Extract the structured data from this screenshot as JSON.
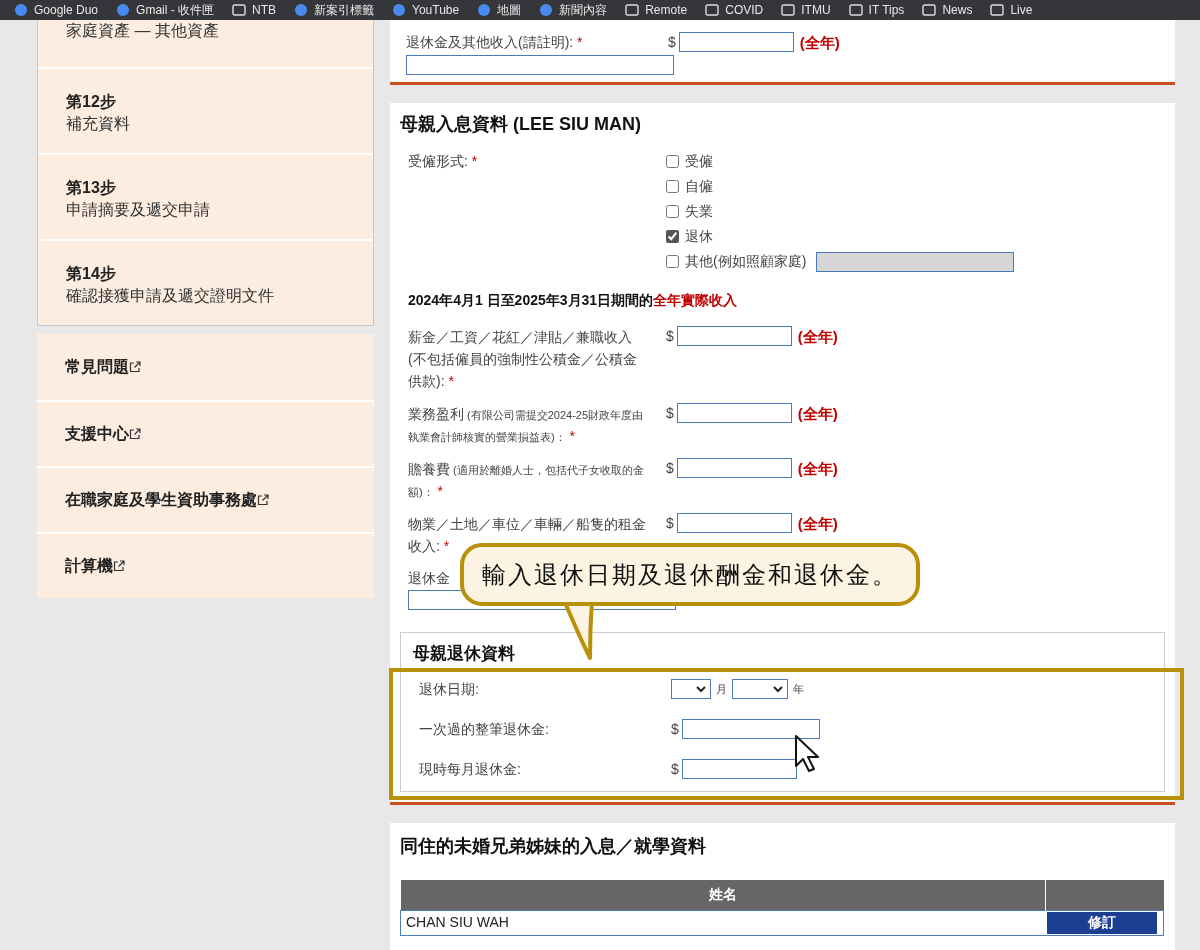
{
  "bookmarks": [
    {
      "label": "Google Duo",
      "kind": "site"
    },
    {
      "label": "Gmail - 收件匣",
      "kind": "site"
    },
    {
      "label": "NTB",
      "kind": "folder"
    },
    {
      "label": "新案引標籤",
      "kind": "site"
    },
    {
      "label": "YouTube",
      "kind": "site"
    },
    {
      "label": "地圖",
      "kind": "site"
    },
    {
      "label": "新聞內容",
      "kind": "site"
    },
    {
      "label": "Remote",
      "kind": "folder"
    },
    {
      "label": "COVID",
      "kind": "folder"
    },
    {
      "label": "ITMU",
      "kind": "folder"
    },
    {
      "label": "IT Tips",
      "kind": "folder"
    },
    {
      "label": "News",
      "kind": "folder"
    },
    {
      "label": "Live",
      "kind": "folder"
    }
  ],
  "sidebar": {
    "steps": [
      {
        "title": "家庭資產 — 其他資產"
      },
      {
        "step": "第12步",
        "title": "補充資料"
      },
      {
        "step": "第13步",
        "title": "申請摘要及遞交申請"
      },
      {
        "step": "第14步",
        "title": "確認接獲申請及遞交證明文件"
      }
    ],
    "links": [
      "常見問題",
      "支援中心",
      "在職家庭及學生資助事務處",
      "計算機"
    ]
  },
  "top_field": {
    "label": "退休金及其他收入(請註明):",
    "mark": "*",
    "currency": "$",
    "suffix": "(全年)"
  },
  "mother": {
    "title": "母親入息資料 (LEE SIU MAN)",
    "employment": {
      "label": "受僱形式:",
      "mark": "*",
      "options": [
        {
          "label": "受僱",
          "checked": false
        },
        {
          "label": "自僱",
          "checked": false
        },
        {
          "label": "失業",
          "checked": false
        },
        {
          "label": "退休",
          "checked": true
        },
        {
          "label": "其他(例如照顧家庭)",
          "checked": false,
          "other_field": true
        }
      ]
    },
    "income_heading": "2024年4月1 日至2025年3月31日期間的",
    "income_heading_red": "全年實際收入",
    "incomes": [
      {
        "label": "薪金／工資／花紅／津貼／兼職收入 (不包括僱員的強制性公積金／公積金供款):",
        "mark": "*",
        "currency": "$",
        "suffix": "(全年)"
      },
      {
        "label": "業務盈利",
        "note": "(有限公司需提交2024-25財政年度由執業會計師核實的營業損益表)：",
        "mark": "*",
        "currency": "$",
        "suffix": "(全年)"
      },
      {
        "label": "贍養費",
        "note": "(適用於離婚人士，包括代子女收取的金額)：",
        "mark": "*",
        "currency": "$",
        "suffix": "(全年)"
      },
      {
        "label": "物業／土地／車位／車輛／船隻的租金收入:",
        "mark": "*",
        "currency": "$",
        "suffix": "(全年)"
      }
    ],
    "partial_label": "退休金"
  },
  "retirement": {
    "title": "母親退休資料",
    "date_label": "退休日期:",
    "month": "月",
    "year": "年",
    "fields": [
      {
        "label": "一次過的整筆退休金:",
        "currency": "$"
      },
      {
        "label": "現時每月退休金:",
        "currency": "$"
      }
    ]
  },
  "siblings": {
    "title": "同住的未婚兄弟姊妹的入息／就學資料",
    "columns": [
      "姓名"
    ],
    "rows": [
      {
        "name": "CHAN SIU WAH",
        "action": "修訂"
      }
    ]
  },
  "callout": "輸入退休日期及退休酬金和退休金。"
}
